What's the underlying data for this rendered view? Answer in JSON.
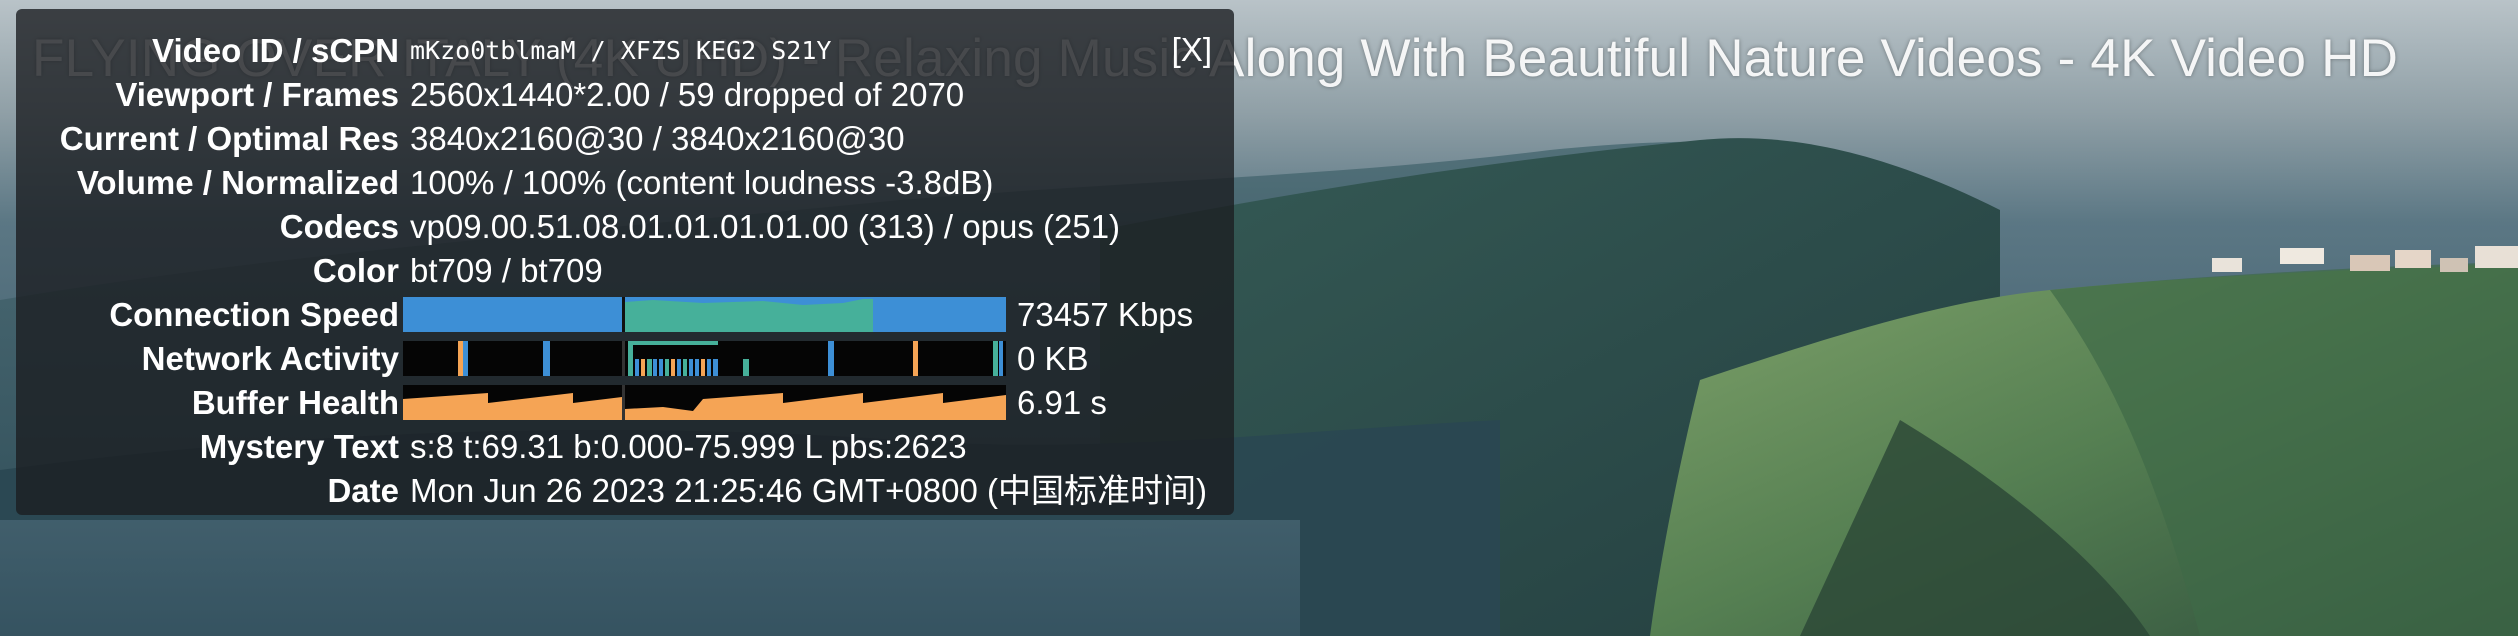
{
  "video": {
    "title": "FLYING OVER ITALY (4K UHD) - Relaxing Music Along With Beautiful Nature Videos - 4K Video HD"
  },
  "stats_panel": {
    "close_label": "[X]",
    "rows": [
      {
        "label": "Video ID / sCPN",
        "value": "mKzo0tblmaM / XFZS KEG2 S21Y"
      },
      {
        "label": "Viewport / Frames",
        "value": "2560x1440*2.00 / 59 dropped of 2070"
      },
      {
        "label": "Current / Optimal Res",
        "value": "3840x2160@30 / 3840x2160@30"
      },
      {
        "label": "Volume / Normalized",
        "value": "100% / 100% (content loudness -3.8dB)"
      },
      {
        "label": "Codecs",
        "value": "vp09.00.51.08.01.01.01.01.00 (313) / opus (251)"
      },
      {
        "label": "Color",
        "value": "bt709 / bt709"
      },
      {
        "label": "Connection Speed",
        "value": "73457 Kbps"
      },
      {
        "label": "Network Activity",
        "value": "0 KB"
      },
      {
        "label": "Buffer Health",
        "value": "6.91 s"
      },
      {
        "label": "Mystery Text",
        "value": "s:8 t:69.31 b:0.000-75.999 L pbs:2623"
      },
      {
        "label": "Date",
        "value": "Mon Jun 26 2023 21:25:46 GMT+0800 (中国标准时间)"
      }
    ]
  },
  "colors": {
    "connection_blue": "#3d8fd6",
    "connection_teal": "#46b09a",
    "network_bg": "#050505",
    "network_spike": "#3d8fd6",
    "buffer_orange": "#f5a455",
    "buffer_bg": "#050505"
  }
}
